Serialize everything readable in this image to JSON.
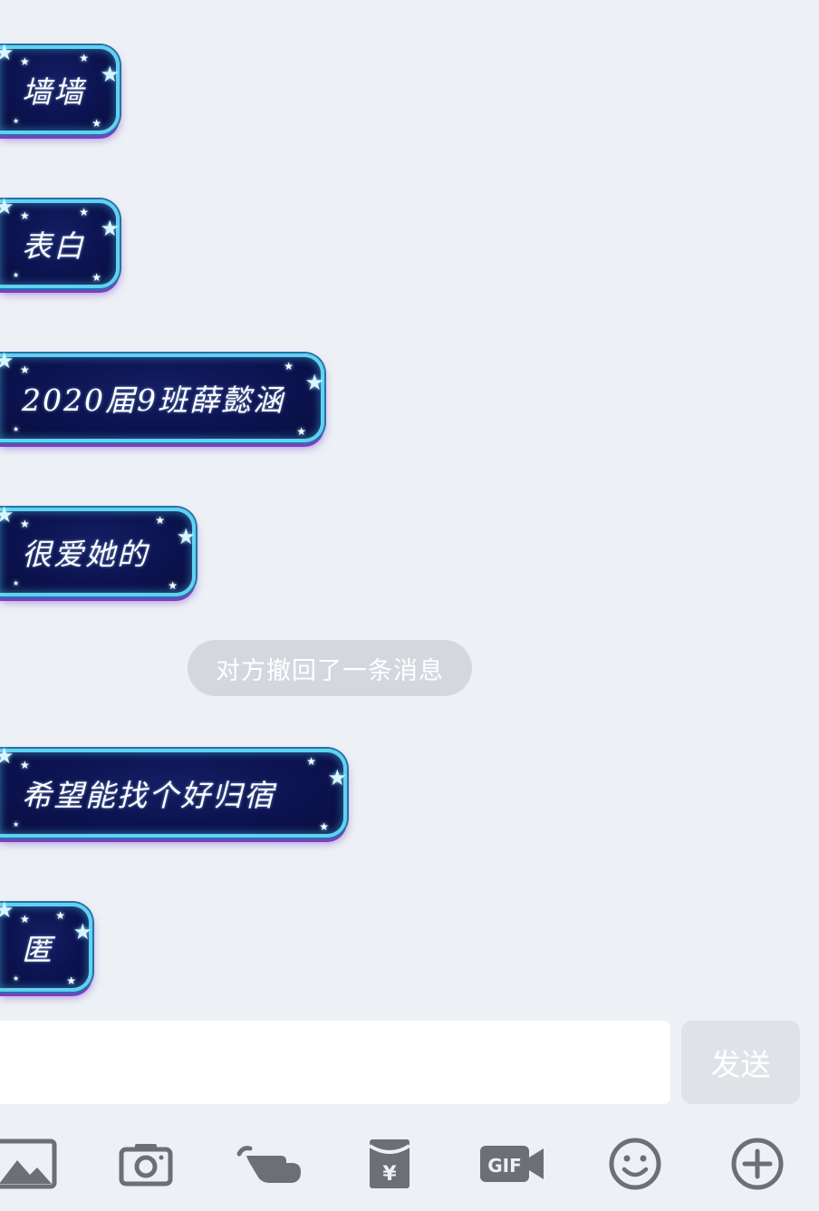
{
  "messages": [
    {
      "text": "墙墙"
    },
    {
      "text": "表白"
    },
    {
      "text": "2020届9班薛懿涵"
    },
    {
      "text": "很爱她的"
    },
    {
      "text": "希望能找个好归宿"
    },
    {
      "text": "匿"
    }
  ],
  "system_notice": "对方撤回了一条消息",
  "input": {
    "value": "",
    "placeholder": ""
  },
  "send_label": "发送",
  "toolbar": [
    {
      "icon": "image-icon"
    },
    {
      "icon": "camera-icon"
    },
    {
      "icon": "poke-icon"
    },
    {
      "icon": "red-envelope-icon"
    },
    {
      "icon": "gif-icon"
    },
    {
      "icon": "emoji-icon"
    },
    {
      "icon": "plus-icon"
    }
  ],
  "colors": {
    "background": "#edf1f6",
    "bubble_fill": "#0c1350",
    "bubble_glow": "#5fd2f0",
    "bubble_underglow": "#7b3fc4",
    "notice_pill": "#d4d8de",
    "send_button": "#dfe3e8",
    "icon_gray": "#6c6f74"
  }
}
